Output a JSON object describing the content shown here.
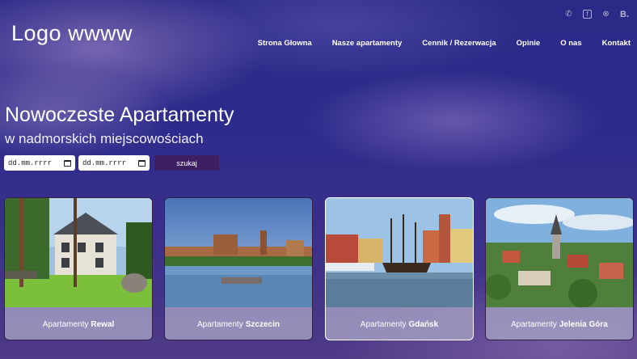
{
  "header": {
    "logo": "Logo wwww",
    "social": [
      {
        "icon": "phone-icon",
        "glyph": "✆",
        "boxed": false
      },
      {
        "icon": "facebook-icon",
        "glyph": "f",
        "boxed": true
      },
      {
        "icon": "tripadvisor-icon",
        "glyph": "⊗",
        "boxed": false
      },
      {
        "icon": "booking-icon",
        "glyph": "B.",
        "boxed": false
      }
    ],
    "nav": [
      "Strona Głowna",
      "Nasze apartamenty",
      "Cennik / Rezerwacja",
      "Opinie",
      "O nas",
      "Kontakt"
    ]
  },
  "hero": {
    "title": "Nowoczeste Apartamenty",
    "subtitle": "w nadmorskich miejscowościach"
  },
  "search": {
    "date_from": "dd.mm.rrrr",
    "date_to": "dd.mm.rrrr",
    "button": "szukaj"
  },
  "cards": [
    {
      "prefix": "Apartamenty",
      "city": "Rewal"
    },
    {
      "prefix": "Apartamenty",
      "city": "Szczecin"
    },
    {
      "prefix": "Apartamenty",
      "city": "Gdańsk"
    },
    {
      "prefix": "Apartamenty",
      "city": "Jelenia Góra"
    }
  ]
}
